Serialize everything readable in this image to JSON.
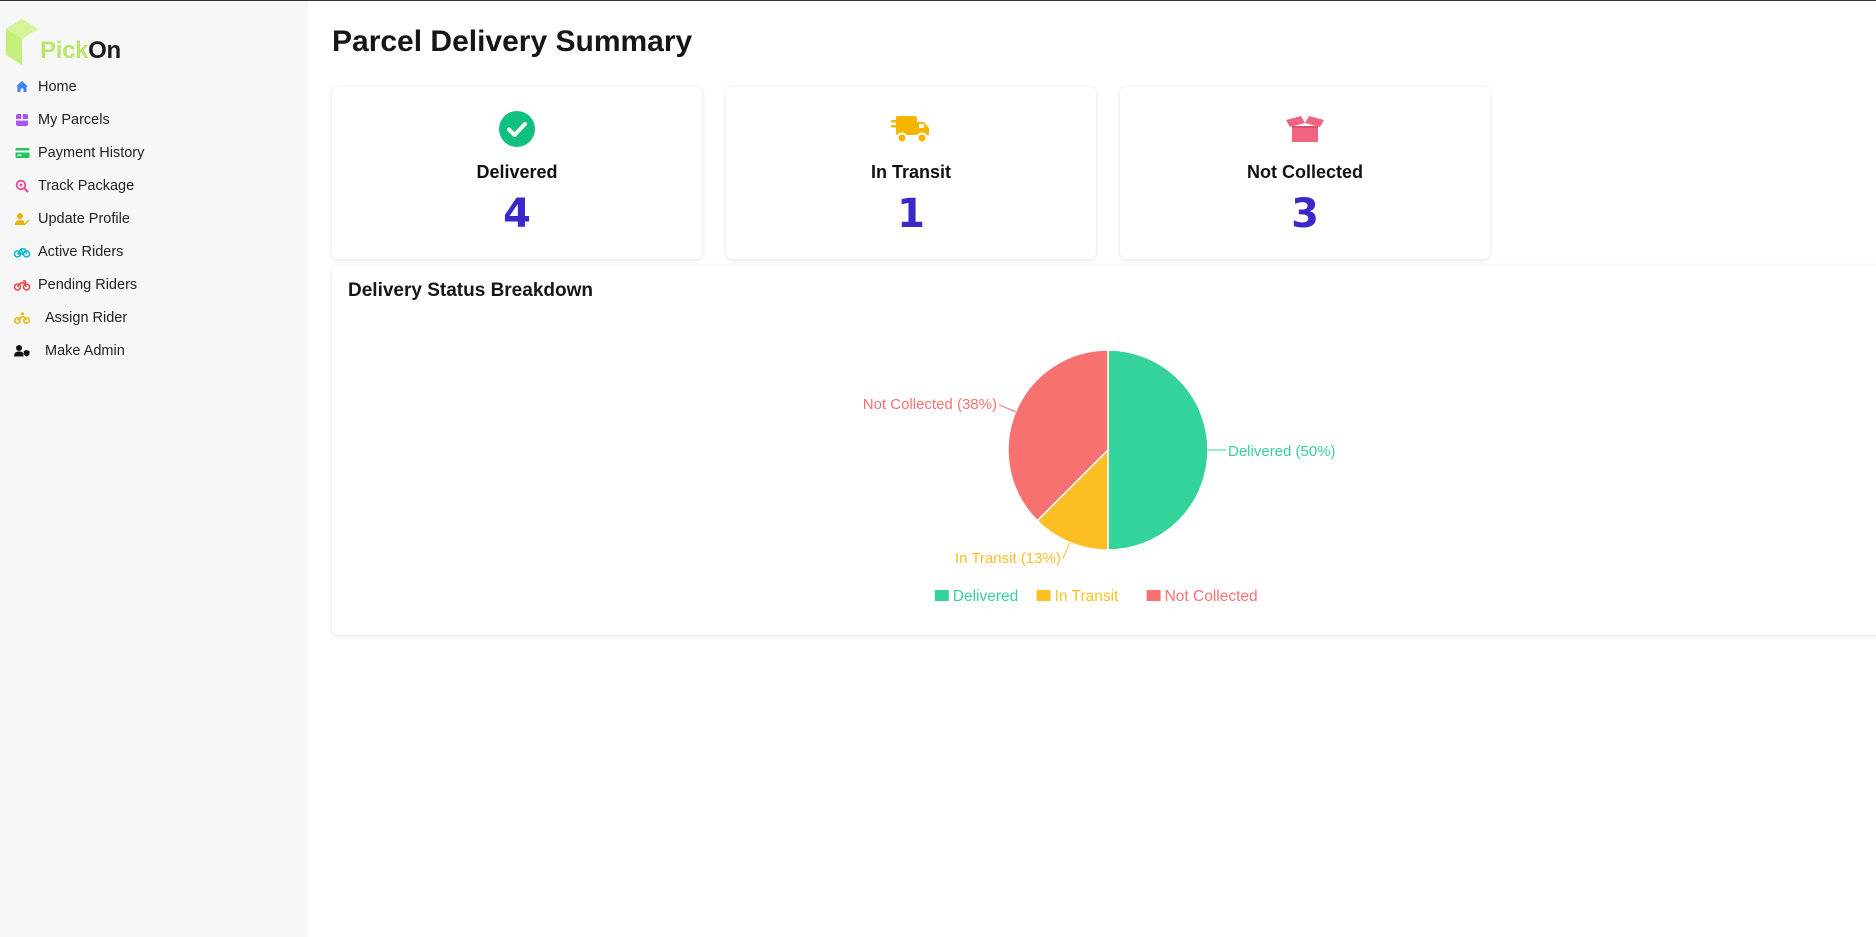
{
  "app": {
    "brand_part1": "Pick",
    "brand_part2": "On"
  },
  "sidebar": {
    "items": [
      {
        "label": "Home",
        "icon": "home-icon",
        "color": "#3b82f6"
      },
      {
        "label": "My Parcels",
        "icon": "box-icon",
        "color": "#a855f7"
      },
      {
        "label": "Payment History",
        "icon": "credit-card-icon",
        "color": "#22c55e"
      },
      {
        "label": "Track Package",
        "icon": "search-location-icon",
        "color": "#ec4899"
      },
      {
        "label": "Update Profile",
        "icon": "user-edit-icon",
        "color": "#eab308"
      },
      {
        "label": "Active Riders",
        "icon": "bicycle-icon",
        "color": "#06b6d4"
      },
      {
        "label": "Pending Riders",
        "icon": "motorcycle-icon",
        "color": "#ef4444"
      },
      {
        "label": "Assign Rider",
        "icon": "rider-icon",
        "color": "#eab308"
      },
      {
        "label": "Make Admin",
        "icon": "user-shield-icon",
        "color": "#111111"
      }
    ]
  },
  "main": {
    "title": "Parcel Delivery Summary",
    "cards": [
      {
        "label": "Delivered",
        "value": "4",
        "icon": "check-circle-icon",
        "color": "#10c07f"
      },
      {
        "label": "In Transit",
        "value": "1",
        "icon": "truck-icon",
        "color": "#f5b400"
      },
      {
        "label": "Not Collected",
        "value": "3",
        "icon": "open-box-icon",
        "color": "#f26380"
      }
    ]
  },
  "chart_data": {
    "type": "pie",
    "title": "Delivery Status Breakdown",
    "categories": [
      "Delivered",
      "In Transit",
      "Not Collected"
    ],
    "values": [
      4,
      1,
      3
    ],
    "slice_labels": [
      "Delivered (50%)",
      "In Transit (13%)",
      "Not Collected (38%)"
    ],
    "colors": [
      "#34d399",
      "#fbbf24",
      "#f87171"
    ],
    "legend": "bottom"
  }
}
